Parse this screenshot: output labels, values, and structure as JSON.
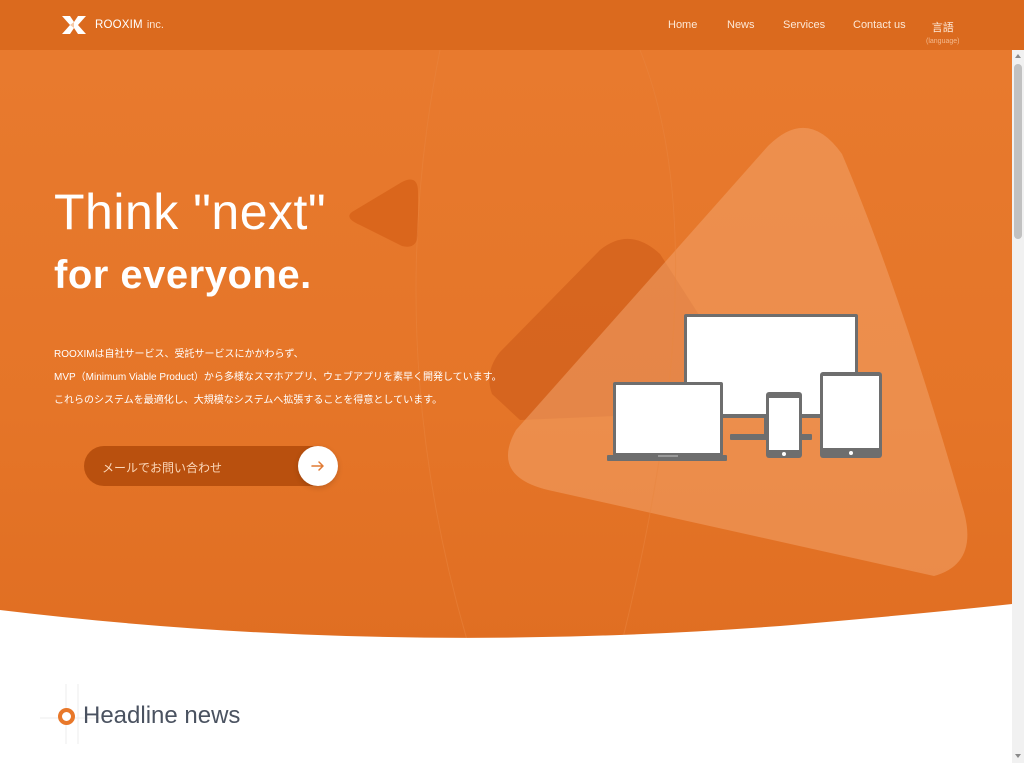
{
  "brand": {
    "name": "ROOXIM",
    "suffix": "inc."
  },
  "nav": {
    "items": [
      {
        "label": "Home"
      },
      {
        "label": "News"
      },
      {
        "label": "Services"
      },
      {
        "label": "Contact us"
      }
    ],
    "language": {
      "label": "言語",
      "sublabel": "(language)"
    }
  },
  "hero": {
    "title_line1": "Think \"next\"",
    "title_line2": "for everyone.",
    "description": [
      "ROOXIMは自社サービス、受託サービスにかかわらず、",
      "MVP（Minimum Viable Product）から多様なスマホアプリ、ウェブアプリを素早く開発しています。",
      "これらのシステムを最適化し、大規模なシステムへ拡張することを得意としています。"
    ],
    "cta_label": "メールでお問い合わせ"
  },
  "news": {
    "title": "Headline news"
  },
  "colors": {
    "brand_orange": "#e57528",
    "header_orange": "#db6a1e",
    "cta_dark": "#b9500e"
  },
  "icons": {
    "logo": "rooxim-x-logo",
    "cta_arrow": "arrow-right-icon",
    "devices": "multi-device-illustration",
    "news_marker": "orange-ring-icon"
  }
}
